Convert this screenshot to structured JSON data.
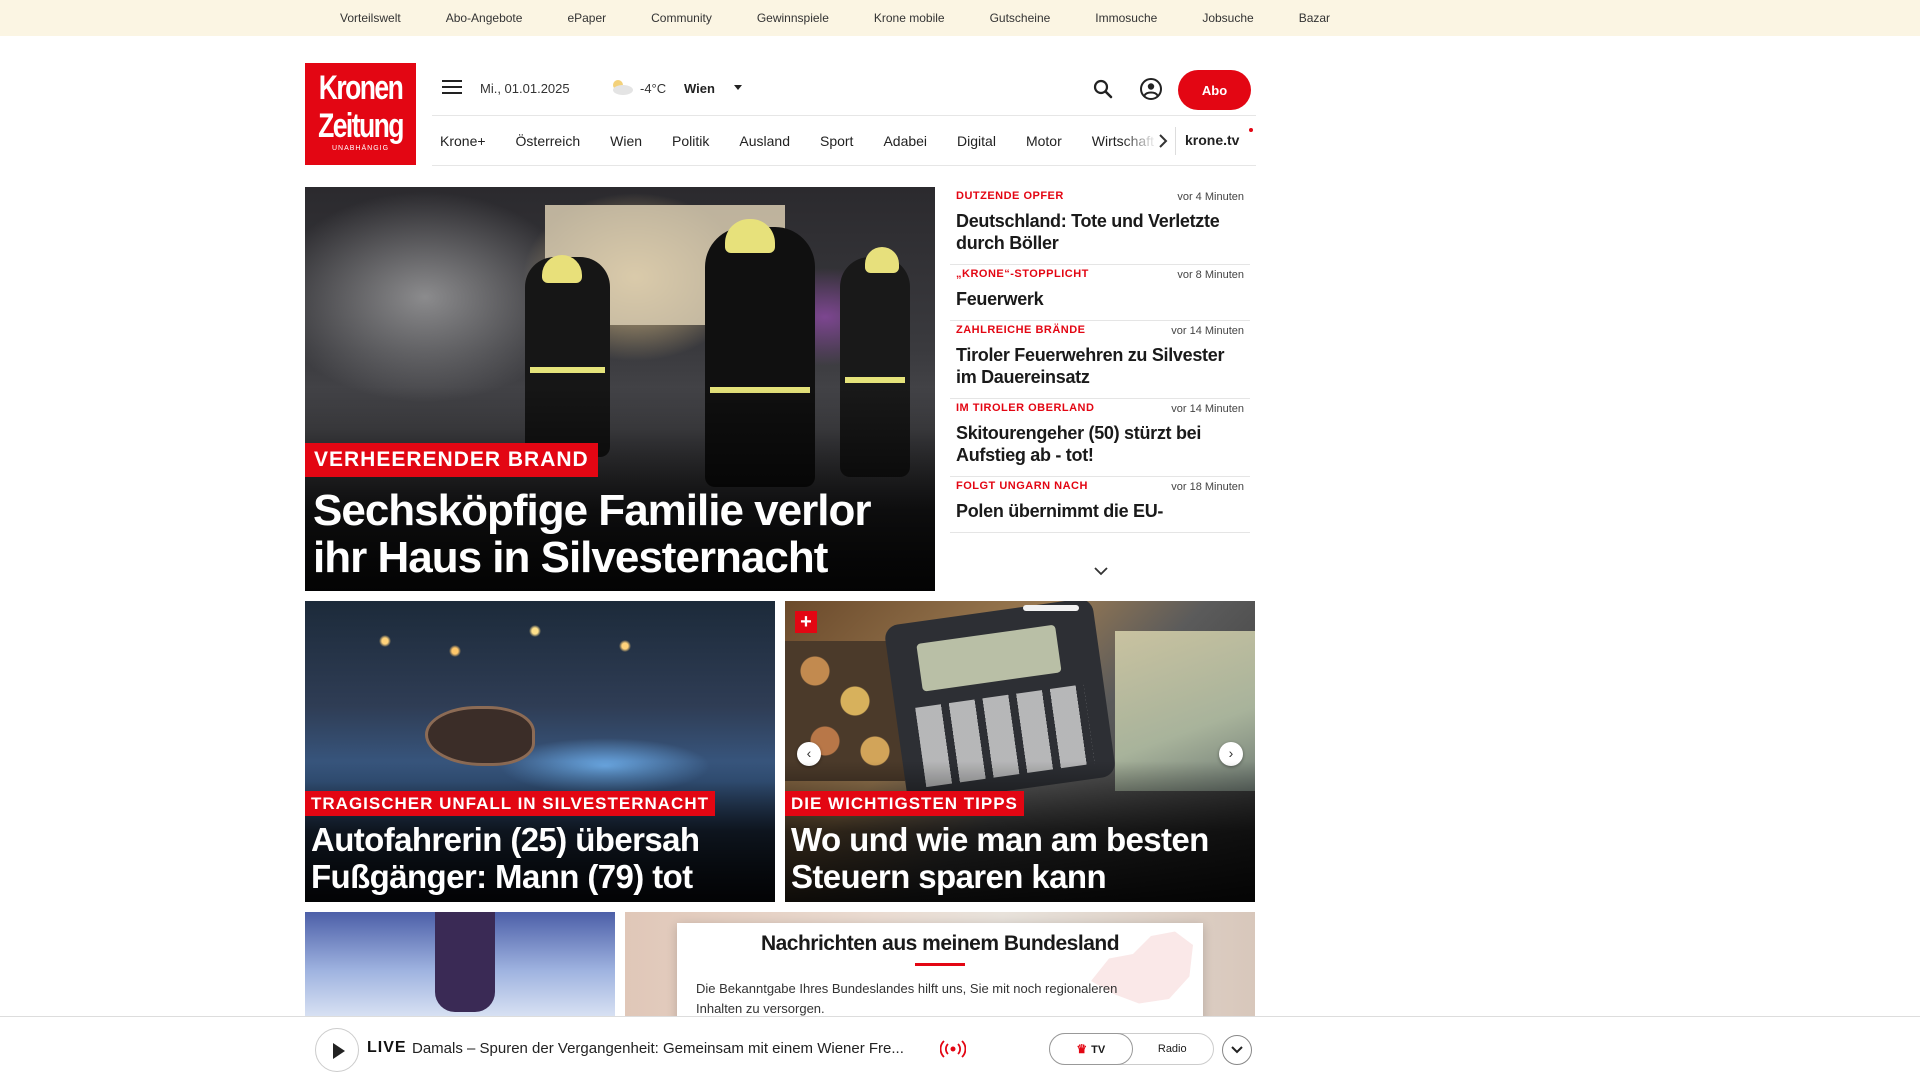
{
  "topbar": {
    "links": [
      "Vorteilswelt",
      "Abo-Angebote",
      "ePaper",
      "Community",
      "Gewinnspiele",
      "Krone mobile",
      "Gutscheine",
      "Immosuche",
      "Jobsuche",
      "Bazar"
    ]
  },
  "logo": {
    "line1": "Kronen",
    "line2": "Zeitung",
    "tagline": "UNABHÄNGIG",
    "color": "#e30613"
  },
  "header": {
    "menu_icon": "hamburger-menu-icon",
    "date": "Mi., 01.01.2025",
    "weather_icon": "partly-cloudy-icon",
    "temperature": "-4°C",
    "city": "Wien",
    "search_icon": "search-icon",
    "account_icon": "user-account-icon",
    "abo_label": "Abo"
  },
  "nav": {
    "items": [
      "Krone+",
      "Österreich",
      "Wien",
      "Politik",
      "Ausland",
      "Sport",
      "Adabei",
      "Digital",
      "Motor",
      "Wirtschaft"
    ],
    "scroll_icon": "chevron-right-icon",
    "tv_label": "krone.tv"
  },
  "hero": {
    "kicker": "VERHEERENDER BRAND",
    "title": "Sechsköpfige Familie verlor ihr Haus in Silvesternacht"
  },
  "ticker": [
    {
      "kicker": "DUTZENDE OPFER",
      "time": "vor 4 Minuten",
      "title": "Deutschland: Tote und Verletzte durch Böller"
    },
    {
      "kicker": "„KRONE“-STOPPLICHT",
      "time": "vor 8 Minuten",
      "title": "Feuerwerk"
    },
    {
      "kicker": "ZAHLREICHE BRÄNDE",
      "time": "vor 14 Minuten",
      "title": "Tiroler Feuerwehren zu Silvester im Dauereinsatz"
    },
    {
      "kicker": "IM TIROLER OBERLAND",
      "time": "vor 14 Minuten",
      "title": "Skitourengeher (50) stürzt bei Aufstieg ab - tot!"
    },
    {
      "kicker": "FOLGT UNGARN NACH",
      "time": "vor 18 Minuten",
      "title": "Polen übernimmt die EU-"
    }
  ],
  "cards": [
    {
      "kicker": "TRAGISCHER UNFALL IN SILVESTERNACHT",
      "title": "Autofahrerin (25) übersah Fußgänger: Mann (79) tot"
    },
    {
      "kicker": "DIE WICHTIGSTEN TIPPS",
      "title": "Wo und wie man am besten Steuern sparen kann",
      "plus": "+",
      "prev": "‹",
      "next": "›"
    }
  ],
  "bundesland": {
    "title": "Nachrichten aus meinem Bundesland",
    "text": "Die Bekanntgabe Ihres Bundeslandes hilft uns, Sie mit noch regionaleren Inhalten zu versorgen."
  },
  "player": {
    "live_label": "LIVE",
    "live_text": "Damals – Spuren der Vergangenheit: Gemeinsam mit einem Wiener Fre...",
    "broadcast_icon": "broadcast-icon",
    "tv_label": "TV",
    "radio_label": "Radio",
    "expand_icon": "chevron-down-icon"
  },
  "colors": {
    "accent": "#e30613",
    "topbar_bg": "#fbf5e3"
  }
}
